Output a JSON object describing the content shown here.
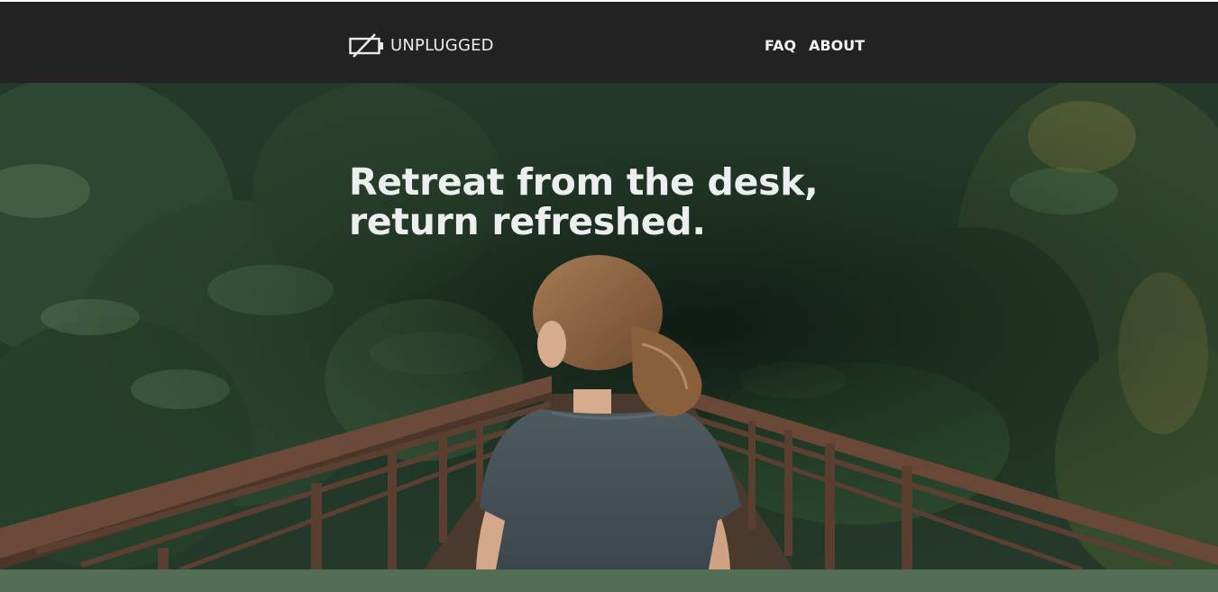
{
  "header": {
    "brand": {
      "name": "UNPLUGGED",
      "icon": "unplugged-battery-icon"
    },
    "nav": [
      {
        "label": "FAQ"
      },
      {
        "label": "ABOUT"
      }
    ]
  },
  "hero": {
    "headline_line1": "Retreat from the desk,",
    "headline_line2": "return refreshed."
  },
  "colors": {
    "header_bg": "#222222",
    "header_text": "#f2f2f2",
    "headline_text": "#eceef0",
    "band": "#536e54"
  }
}
